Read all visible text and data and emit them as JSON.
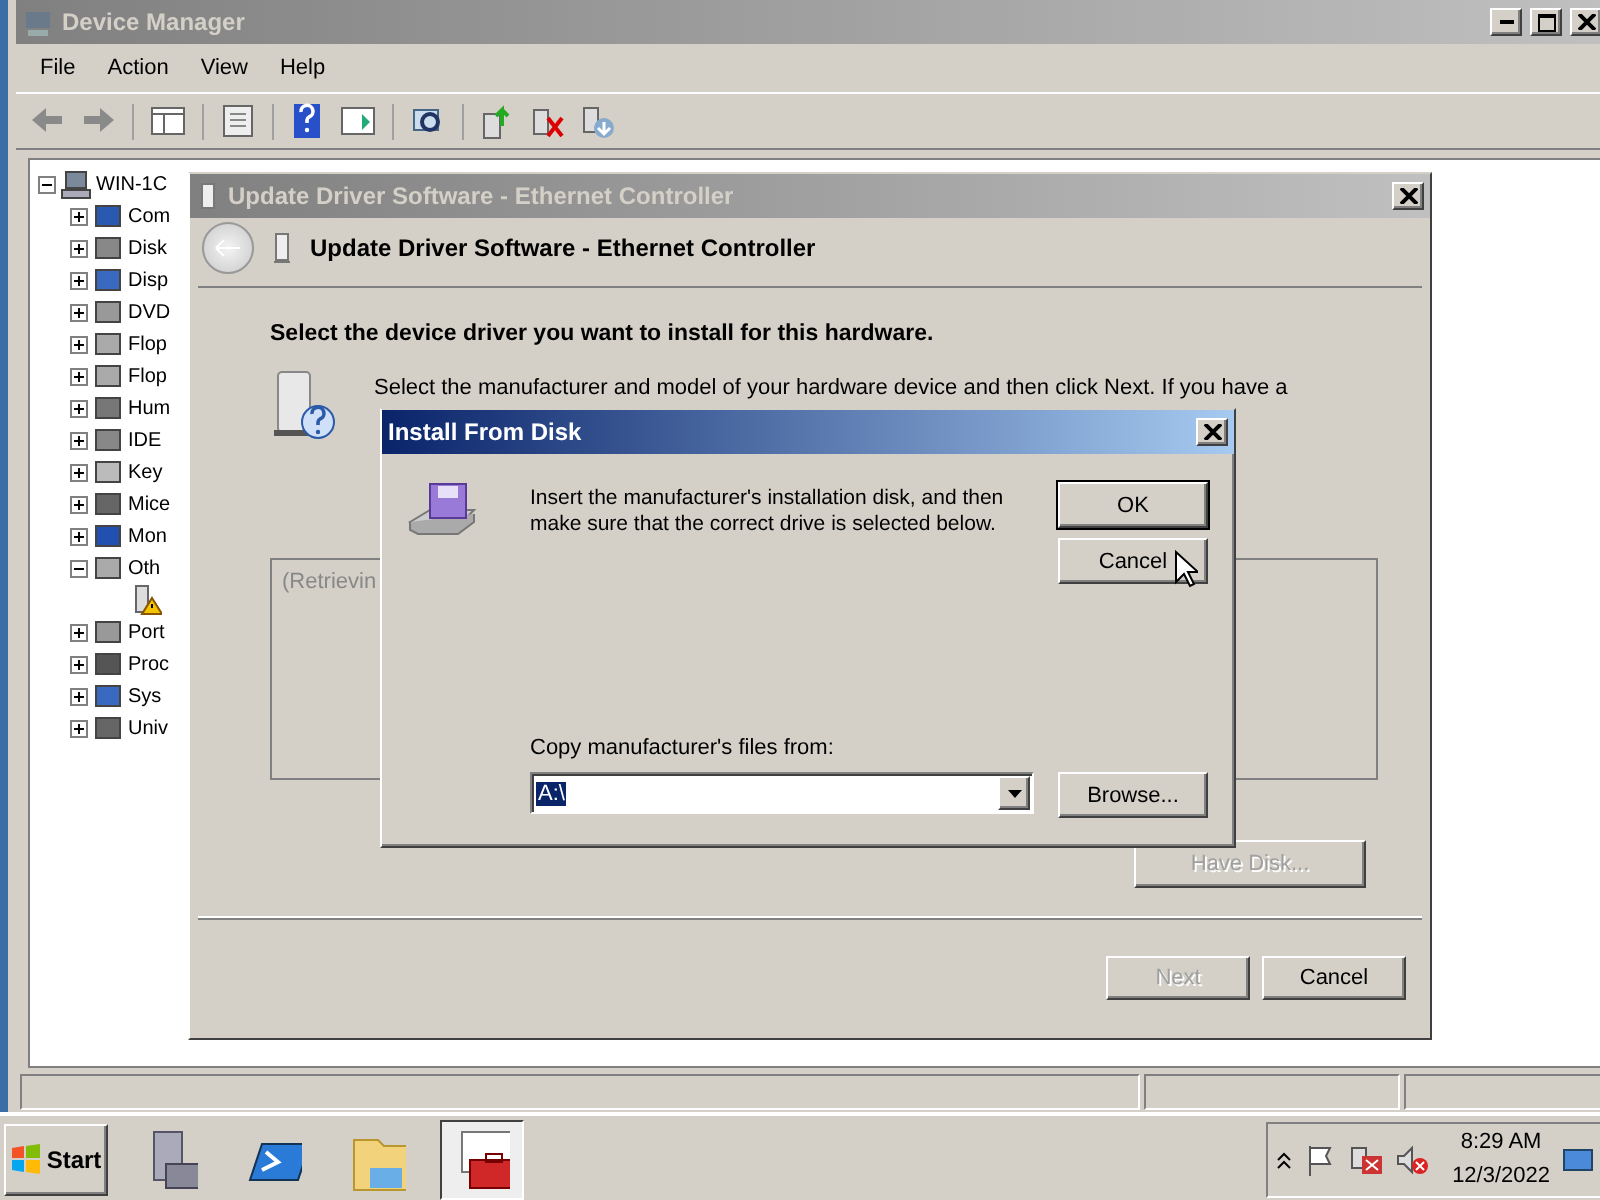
{
  "device_manager": {
    "title": "Device Manager",
    "active": false,
    "menu": [
      "File",
      "Action",
      "View",
      "Help"
    ],
    "tree": {
      "label": "WIN-1C",
      "expanded": true,
      "children": [
        {
          "label": "Com",
          "expanded": false
        },
        {
          "label": "Disk",
          "expanded": false
        },
        {
          "label": "Disp",
          "expanded": false
        },
        {
          "label": "DVD",
          "expanded": false
        },
        {
          "label": "Flop",
          "expanded": false
        },
        {
          "label": "Flop",
          "expanded": false
        },
        {
          "label": "Hum",
          "expanded": false
        },
        {
          "label": "IDE",
          "expanded": false
        },
        {
          "label": "Key",
          "expanded": false
        },
        {
          "label": "Mice",
          "expanded": false
        },
        {
          "label": "Mon",
          "expanded": false
        },
        {
          "label": "Oth",
          "expanded": true,
          "children": [
            {
              "kind": "warning-device"
            }
          ]
        },
        {
          "label": "Port",
          "expanded": false
        },
        {
          "label": "Proc",
          "expanded": false
        },
        {
          "label": "Sys",
          "expanded": false
        },
        {
          "label": "Univ",
          "expanded": false
        }
      ]
    }
  },
  "update_dialog": {
    "title": "Update Driver Software - Ethernet Controller",
    "active": false,
    "header": "Update Driver Software - Ethernet Controller",
    "heading": "Select the device driver you want to install for this hardware.",
    "instruction": "Select the manufacturer and model of your hardware device and then click Next. If you have a",
    "list_text": "(Retrievin",
    "have_disk": {
      "label": "Have Disk...",
      "disabled": true
    },
    "buttons": [
      {
        "label": "Next",
        "disabled": true
      },
      {
        "label": "Cancel",
        "disabled": false
      }
    ]
  },
  "install_dialog": {
    "title": "Install From Disk",
    "active": true,
    "message": "Insert the manufacturer's installation disk, and then make sure that the correct drive is selected below.",
    "buttons": [
      {
        "label": "OK",
        "default": true
      },
      {
        "label": "Cancel",
        "default": false
      }
    ],
    "copy_label": "Copy manufacturer's files from:",
    "path": {
      "value": "A:\\",
      "selected": true
    },
    "browse": "Browse..."
  },
  "taskbar": {
    "start": "Start",
    "apps": [
      {
        "kind": "server-manager",
        "active": false
      },
      {
        "kind": "powershell",
        "active": false
      },
      {
        "kind": "explorer",
        "active": false
      },
      {
        "kind": "toolbox",
        "active": true
      }
    ],
    "time": "8:29 AM",
    "date": "12/3/2022"
  }
}
